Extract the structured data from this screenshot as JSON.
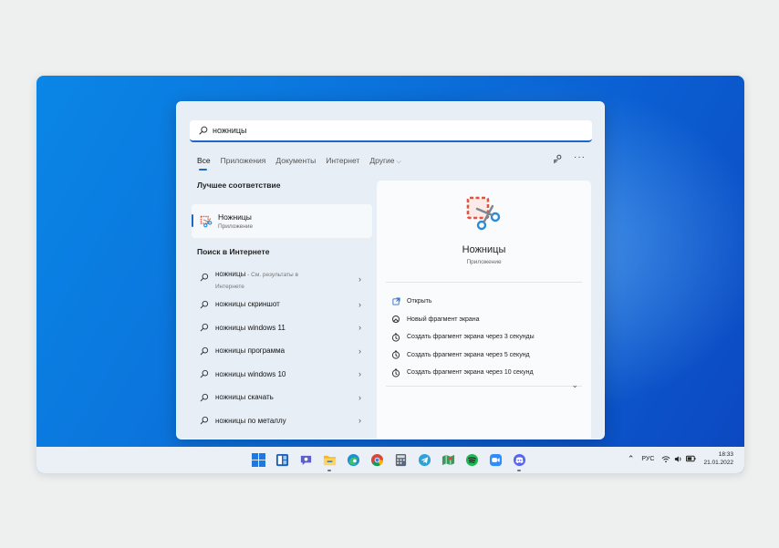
{
  "search": {
    "query": "ножницы"
  },
  "tabs": [
    {
      "label": "Все",
      "active": true
    },
    {
      "label": "Приложения",
      "active": false
    },
    {
      "label": "Документы",
      "active": false
    },
    {
      "label": "Интернет",
      "active": false
    },
    {
      "label": "Другие",
      "active": false,
      "dropdown": true
    }
  ],
  "tab_icons": [
    "share-feedback-icon",
    "more-options-icon"
  ],
  "best_match": {
    "section_title": "Лучшее соответствие",
    "name": "Ножницы",
    "type": "Приложение",
    "icon": "snipping-tool-icon"
  },
  "web_search": {
    "section_title": "Поиск в Интернете",
    "first": {
      "query": "ножницы",
      "hint": " - См. результаты в Интернете"
    },
    "items": [
      {
        "prefix": "ножницы ",
        "suffix": "скриншот"
      },
      {
        "prefix": "ножницы ",
        "suffix": "windows 11"
      },
      {
        "prefix": "ножницы ",
        "suffix": "программа"
      },
      {
        "prefix": "ножницы ",
        "suffix": "windows 10"
      },
      {
        "prefix": "ножницы ",
        "suffix": "скачать"
      },
      {
        "prefix": "ножницы ",
        "suffix": "по металлу"
      }
    ]
  },
  "detail": {
    "name": "Ножницы",
    "type": "Приложение",
    "actions": [
      {
        "label": "Открыть",
        "icon": "open-icon"
      },
      {
        "label": "Новый фрагмент экрана",
        "icon": "new-snip-icon"
      },
      {
        "label": "Создать фрагмент экрана через 3 секунды",
        "icon": "timer-icon"
      },
      {
        "label": "Создать фрагмент экрана через 5 секунд",
        "icon": "timer-icon"
      },
      {
        "label": "Создать фрагмент экрана через 10 секунд",
        "icon": "timer-icon"
      }
    ]
  },
  "taskbar": {
    "apps": [
      "start",
      "widgets",
      "teams-chat",
      "file-explorer",
      "edge",
      "chrome",
      "calculator",
      "telegram",
      "maps",
      "spotify",
      "zoom",
      "discord"
    ],
    "language": "РУС",
    "time": "18:33",
    "date": "21.01.2022"
  },
  "colors": {
    "accent": "#1e66c7",
    "desktop": "#0b6fdc",
    "panel": "#e7eef6"
  }
}
